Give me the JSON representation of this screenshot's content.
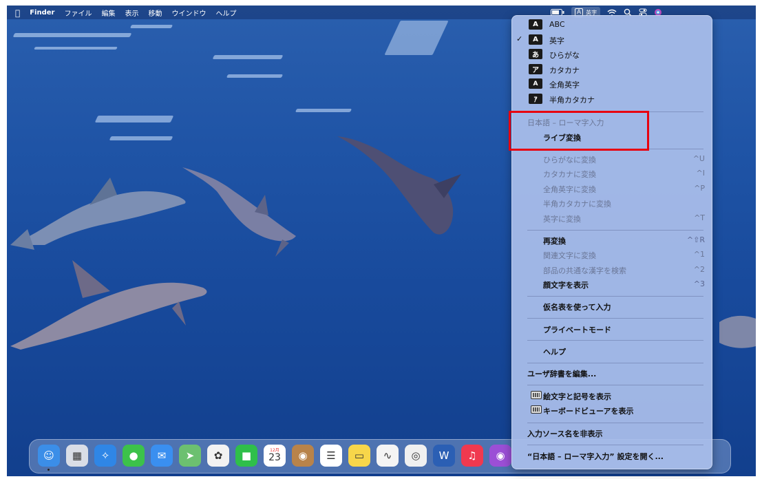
{
  "menubar": {
    "app_name": "Finder",
    "items": [
      "ファイル",
      "編集",
      "表示",
      "移動",
      "ウインドウ",
      "ヘルプ"
    ],
    "ime_indicator": {
      "letter": "A",
      "label": "英字"
    },
    "icons": [
      "battery-icon",
      "wifi-icon",
      "search-icon",
      "control-center-icon",
      "siri-icon"
    ]
  },
  "ime_menu": {
    "input_sources": [
      {
        "badge": "A",
        "label": "ABC",
        "checked": false
      },
      {
        "badge": "A",
        "label": "英字",
        "checked": true
      },
      {
        "badge": "あ",
        "label": "ひらがな",
        "checked": false
      },
      {
        "badge": "ア",
        "label": "カタカナ",
        "checked": false
      },
      {
        "badge": "A",
        "label": "全角英字",
        "checked": false
      },
      {
        "badge": "ｱ",
        "label": "半角カタカナ",
        "checked": false
      }
    ],
    "check_mark": "✓",
    "section_header": "日本語 – ローマ字入力",
    "live_conversion": "ライブ変換",
    "conversions": [
      {
        "label": "ひらがなに変換",
        "shortcut": "^U"
      },
      {
        "label": "カタカナに変換",
        "shortcut": "^I"
      },
      {
        "label": "全角英字に変換",
        "shortcut": "^P"
      },
      {
        "label": "半角カタカナに変換",
        "shortcut": ""
      },
      {
        "label": "英字に変換",
        "shortcut": "^T"
      }
    ],
    "reconvert": {
      "label": "再変換",
      "shortcut": "^⇧R"
    },
    "related": [
      {
        "label": "関連文字に変換",
        "shortcut": "^1",
        "enabled": false
      },
      {
        "label": "部品の共通な漢字を検索",
        "shortcut": "^2",
        "enabled": false
      },
      {
        "label": "顔文字を表示",
        "shortcut": "^3",
        "enabled": true
      }
    ],
    "kana_table": "仮名表を使って入力",
    "private_mode": "プライベートモード",
    "help": "ヘルプ",
    "edit_dictionary": "ユーザ辞書を編集...",
    "show_emoji": "絵文字と記号を表示",
    "show_keyboard_viewer": "キーボードビューアを表示",
    "toggle_source_name": "入力ソース名を非表示",
    "open_settings": "“日本語 – ローマ字入力” 設定を開く..."
  },
  "dock": {
    "items": [
      {
        "name": "finder-icon",
        "glyph": "☺",
        "color": "#3b8ee8"
      },
      {
        "name": "launchpad-icon",
        "glyph": "▦",
        "color": "#d9dde6"
      },
      {
        "name": "safari-icon",
        "glyph": "✧",
        "color": "#2f86e6"
      },
      {
        "name": "messages-icon",
        "glyph": "●",
        "color": "#3cc24a"
      },
      {
        "name": "mail-icon",
        "glyph": "✉",
        "color": "#3a8ff0"
      },
      {
        "name": "maps-icon",
        "glyph": "➤",
        "color": "#6cc070"
      },
      {
        "name": "photos-icon",
        "glyph": "✿",
        "color": "#f2f2f2"
      },
      {
        "name": "facetime-icon",
        "glyph": "■",
        "color": "#2fbf4a"
      },
      {
        "name": "calendar-icon",
        "glyph": "23",
        "color": "#ffffff",
        "month": "12月"
      },
      {
        "name": "contacts-icon",
        "glyph": "◉",
        "color": "#b8834a"
      },
      {
        "name": "reminders-icon",
        "glyph": "☰",
        "color": "#ffffff"
      },
      {
        "name": "notes-icon",
        "glyph": "▭",
        "color": "#f7d64a"
      },
      {
        "name": "freeform-icon",
        "glyph": "∿",
        "color": "#f4f4f4"
      },
      {
        "name": "chrome-icon",
        "glyph": "◎",
        "color": "#f0f0f0"
      },
      {
        "name": "word-icon",
        "glyph": "W",
        "color": "#2b5fb4"
      },
      {
        "name": "music-icon",
        "glyph": "♫",
        "color": "#f0394f"
      },
      {
        "name": "podcasts-icon",
        "glyph": "◉",
        "color": "#9b4fd6"
      }
    ]
  }
}
